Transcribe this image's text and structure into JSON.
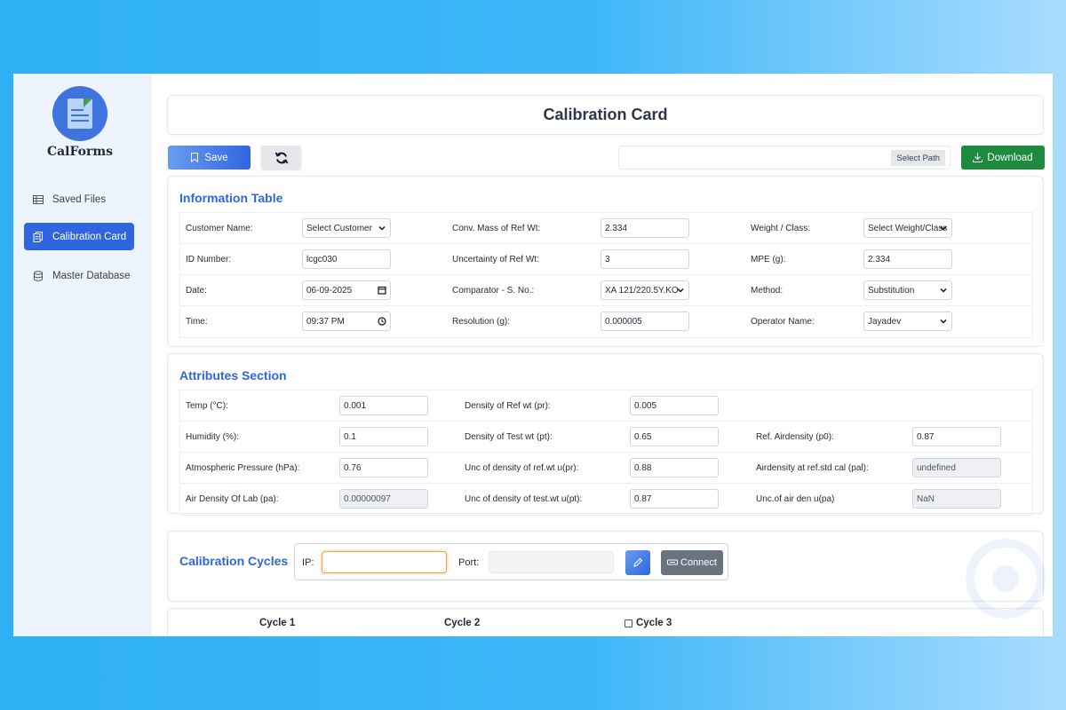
{
  "app": {
    "brand": "CalForms"
  },
  "sidebar": {
    "items": [
      {
        "label": "Saved Files",
        "icon": "table-icon",
        "active": false
      },
      {
        "label": "Calibration Card",
        "icon": "copy-icon",
        "active": true
      },
      {
        "label": "Master Database",
        "icon": "database-icon",
        "active": false
      }
    ]
  },
  "page": {
    "title": "Calibration Card"
  },
  "toolbar": {
    "save_label": "Save",
    "refresh_icon": "refresh-icon",
    "path_value": "",
    "select_path_label": "Select Path",
    "download_label": "Download"
  },
  "info": {
    "title": "Information Table",
    "customer_name": {
      "label": "Customer Name:",
      "value": "Select Customer"
    },
    "conv_mass": {
      "label": "Conv. Mass of Ref Wt:",
      "value": "2.334"
    },
    "weight_class": {
      "label": "Weight / Class:",
      "value": "Select Weight/Class"
    },
    "id_number": {
      "label": "ID Number:",
      "value": "lcgc030"
    },
    "uncertainty_ref": {
      "label": "Uncertainty of Ref Wt:",
      "value": "3"
    },
    "mpe": {
      "label": "MPE (g):",
      "value": "2.334"
    },
    "date": {
      "label": "Date:",
      "value": "06-09-2025"
    },
    "comparator": {
      "label": "Comparator - S. No.:",
      "value": "XA 121/220.5Y.KO"
    },
    "method": {
      "label": "Method:",
      "value": "Substitution"
    },
    "time": {
      "label": "Time:",
      "value": "09:37 PM"
    },
    "resolution": {
      "label": "Resolution (g):",
      "value": "0.000005"
    },
    "operator": {
      "label": "Operator Name:",
      "value": "Jayadev"
    }
  },
  "attributes": {
    "title": "Attributes Section",
    "temp": {
      "label": "Temp (°C):",
      "value": "0.001"
    },
    "density_ref": {
      "label": "Density of Ref wt (pr):",
      "value": "0.005"
    },
    "humidity": {
      "label": "Humidity (%):",
      "value": "0.1"
    },
    "density_test": {
      "label": "Density of Test wt (pt):",
      "value": "0.65"
    },
    "ref_airdensity": {
      "label": "Ref. Airdensity (p0):",
      "value": "0.87"
    },
    "atm_pressure": {
      "label": "Atmospheric Pressure (hPa):",
      "value": "0.76"
    },
    "unc_density_ref": {
      "label": "Unc of density of ref.wt u(pr):",
      "value": "0.88"
    },
    "airdensity_ref_std": {
      "label": "Airdensity at ref.std cal (pal):",
      "value": "undefined"
    },
    "air_density_lab": {
      "label": "Air Density Of Lab (pa):",
      "value": "0.00000097"
    },
    "unc_density_test": {
      "label": "Unc of density of test.wt u(pt):",
      "value": "0.87"
    },
    "unc_air_den": {
      "label": "Unc.of air den u(pa)",
      "value": "NaN"
    }
  },
  "cycles": {
    "title": "Calibration Cycles",
    "ip_label": "IP:",
    "ip_value": "",
    "port_label": "Port:",
    "port_value": "",
    "connect_label": "Connect",
    "headers": [
      "Cycle 1",
      "Cycle 2",
      "Cycle 3"
    ]
  }
}
